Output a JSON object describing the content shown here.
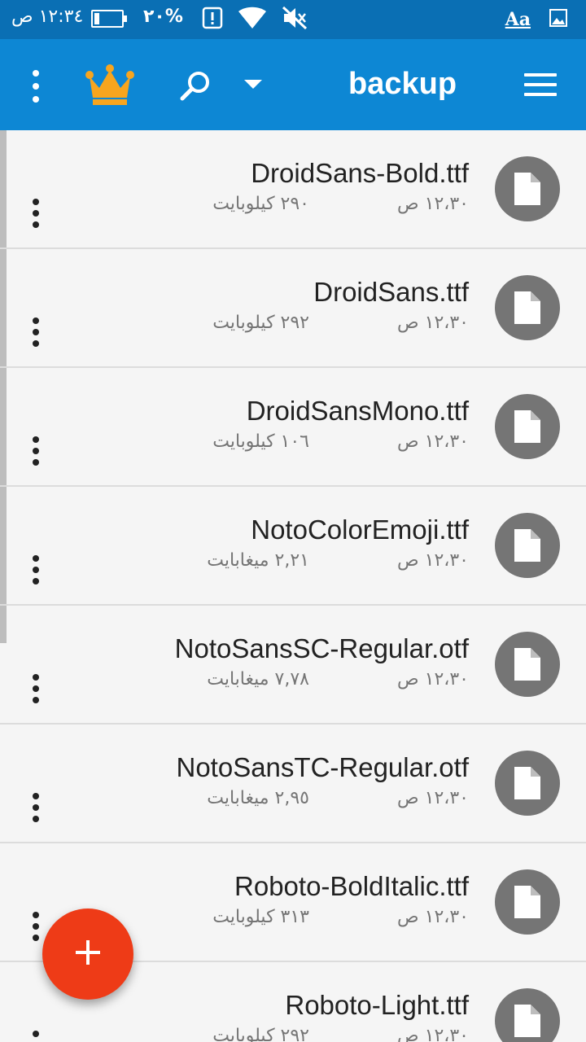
{
  "status_bar": {
    "time": "١٢:٣٤ ص",
    "battery_percent": "٢٠%",
    "battery_level": 0.2,
    "aa_label": "Aa"
  },
  "app_bar": {
    "title": "backup",
    "accent_color": "#0d87d4",
    "crown_color": "#f7a51e"
  },
  "files": [
    {
      "name": "DroidSans-Bold.ttf",
      "size": "٢٩٠ كيلوبايت",
      "date": "١٢،٣٠ ص"
    },
    {
      "name": "DroidSans.ttf",
      "size": "٢٩٢ كيلوبايت",
      "date": "١٢،٣٠ ص"
    },
    {
      "name": "DroidSansMono.ttf",
      "size": "١٠٦ كيلوبايت",
      "date": "١٢،٣٠ ص"
    },
    {
      "name": "NotoColorEmoji.ttf",
      "size": "٢,٢١ ميغابايت",
      "date": "١٢،٣٠ ص"
    },
    {
      "name": "NotoSansSC-Regular.otf",
      "size": "٧,٧٨ ميغابايت",
      "date": "١٢،٣٠ ص"
    },
    {
      "name": "NotoSansTC-Regular.otf",
      "size": "٢,٩٥ ميغابايت",
      "date": "١٢،٣٠ ص"
    },
    {
      "name": "Roboto-BoldItalic.ttf",
      "size": "٣١٣ كيلوبايت",
      "date": "١٢،٣٠ ص"
    },
    {
      "name": "Roboto-Light.ttf",
      "size": "٢٩٢ كيلوبايت",
      "date": "١٢،٣٠ ص"
    }
  ],
  "fab": {
    "label": "+",
    "color": "#ee3b17"
  }
}
